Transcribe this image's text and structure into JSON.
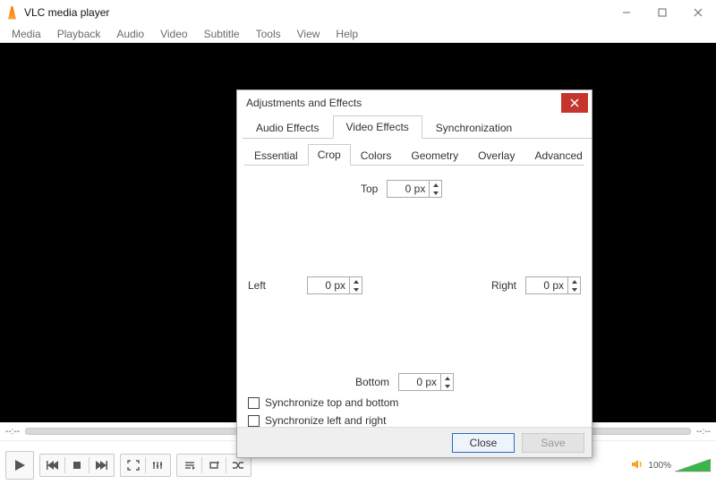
{
  "window": {
    "title": "VLC media player"
  },
  "menu": {
    "items": [
      "Media",
      "Playback",
      "Audio",
      "Video",
      "Subtitle",
      "Tools",
      "View",
      "Help"
    ]
  },
  "time": {
    "current": "--:--",
    "total": "--:--"
  },
  "volume": {
    "label": "100%"
  },
  "dialog": {
    "title": "Adjustments and Effects",
    "main_tabs": [
      "Audio Effects",
      "Video Effects",
      "Synchronization"
    ],
    "main_active": 1,
    "sub_tabs": [
      "Essential",
      "Crop",
      "Colors",
      "Geometry",
      "Overlay",
      "Advanced"
    ],
    "sub_active": 1,
    "crop": {
      "top_label": "Top",
      "top_value": "0 px",
      "left_label": "Left",
      "left_value": "0 px",
      "right_label": "Right",
      "right_value": "0 px",
      "bottom_label": "Bottom",
      "bottom_value": "0 px",
      "sync_tb": "Synchronize top and bottom",
      "sync_lr": "Synchronize left and right"
    },
    "close": "Close",
    "save": "Save"
  }
}
